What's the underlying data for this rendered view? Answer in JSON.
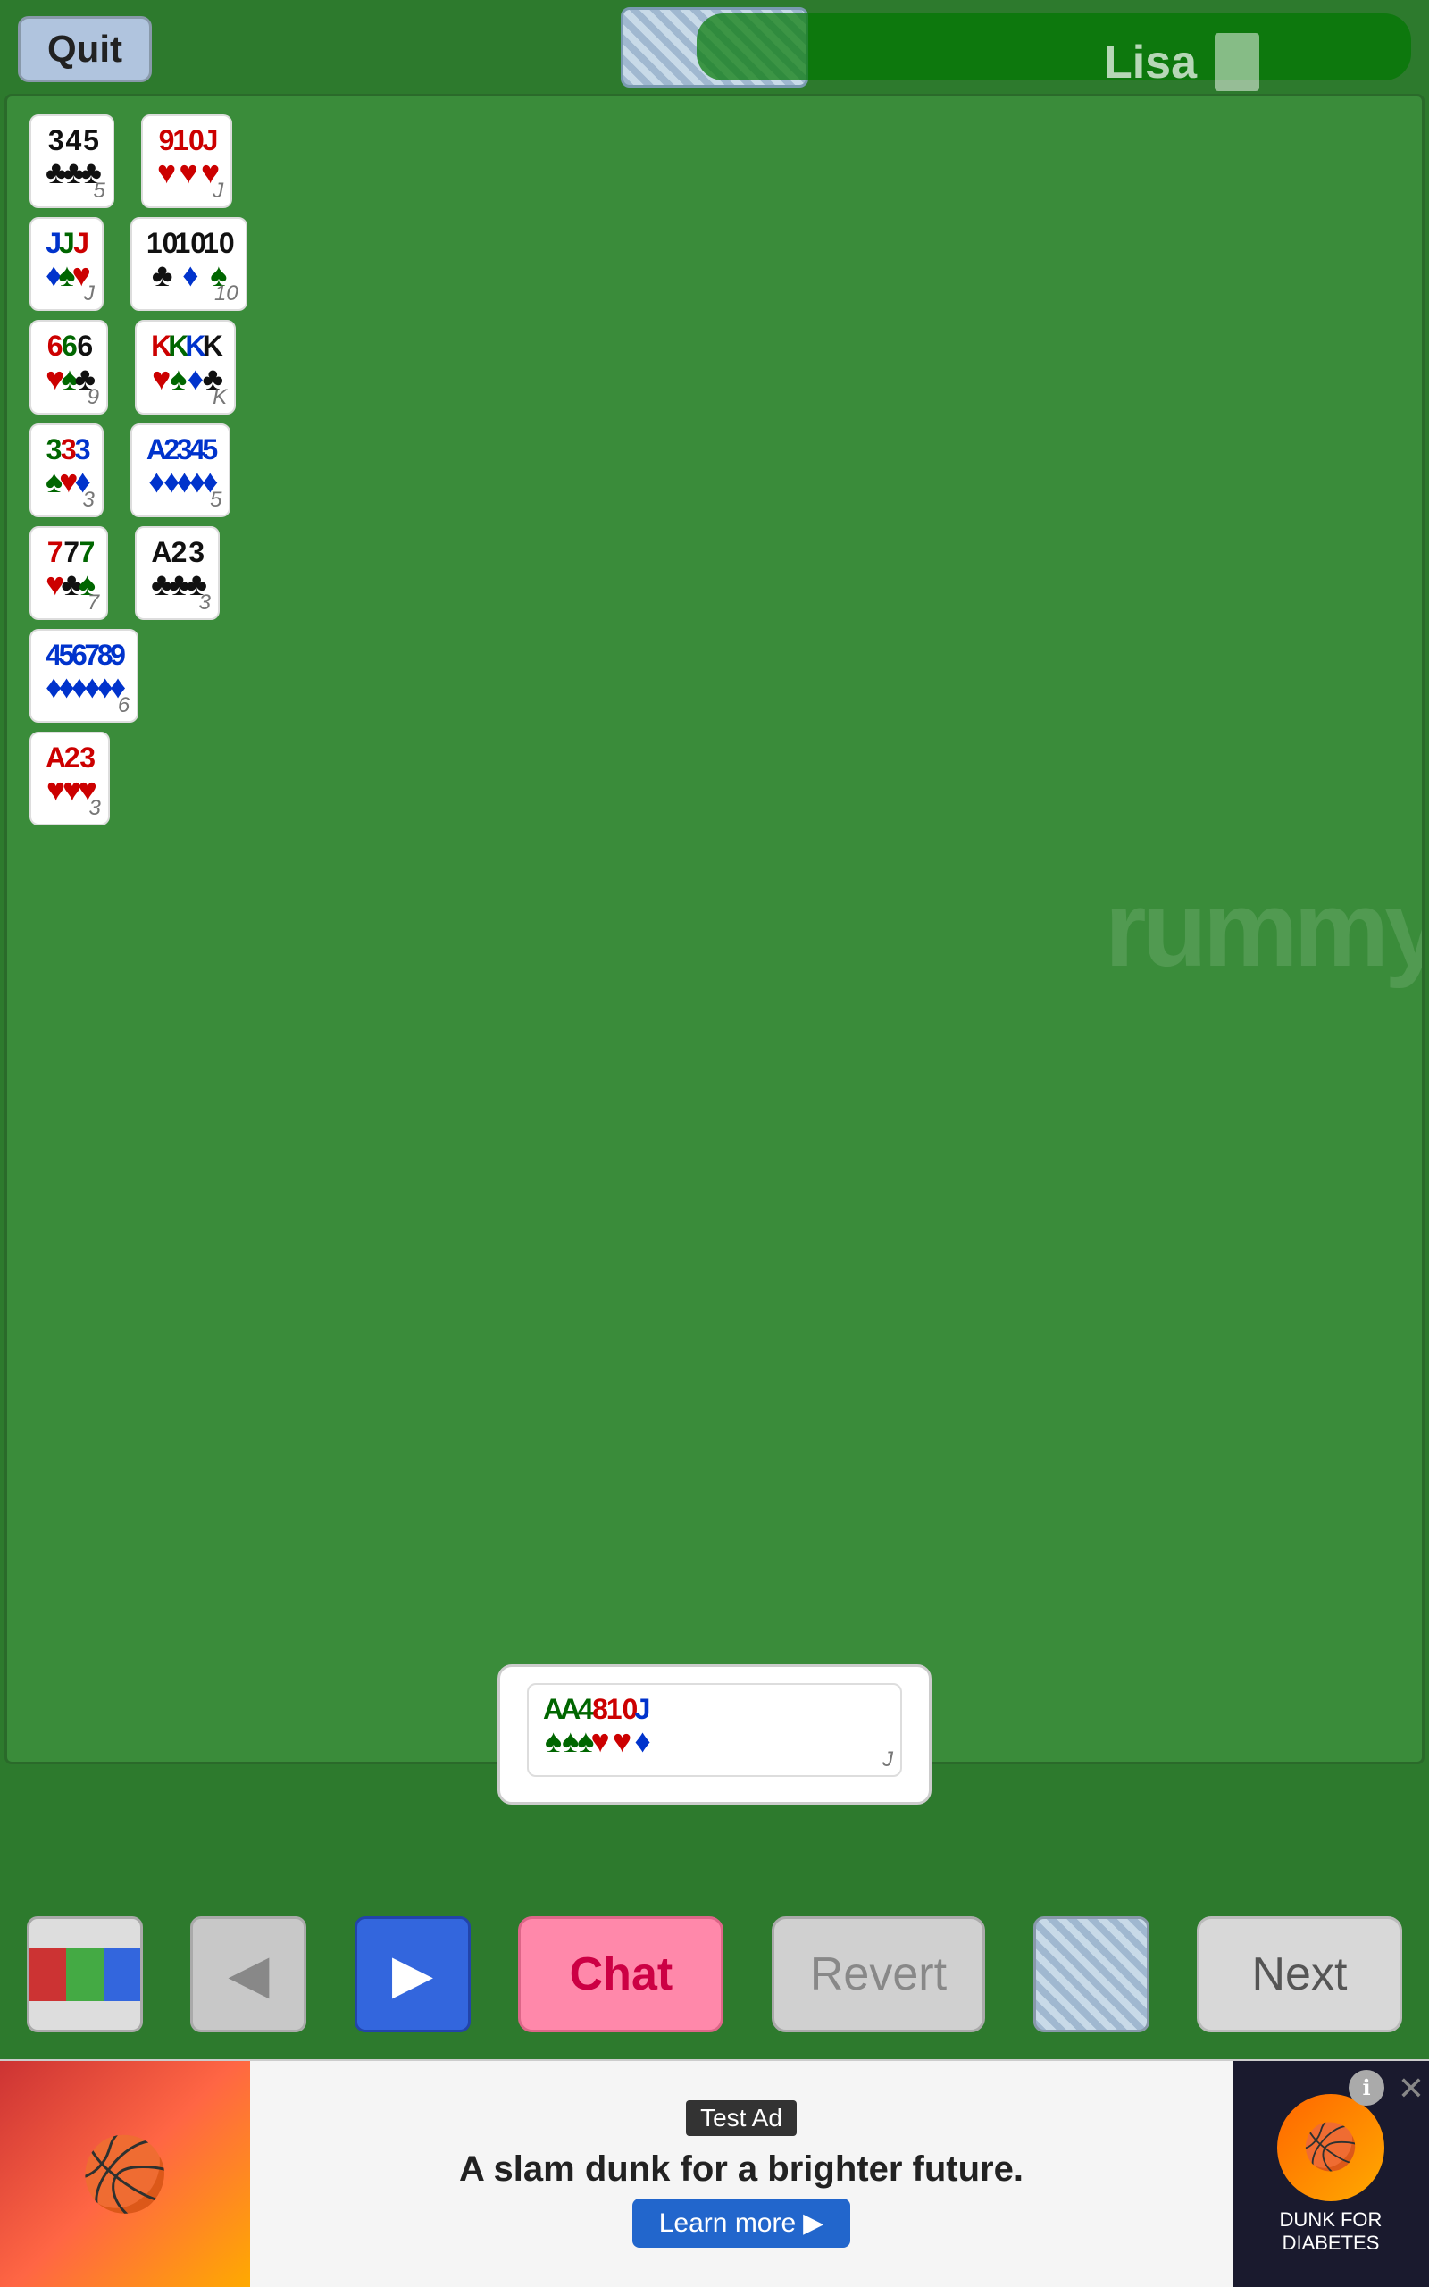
{
  "topBar": {
    "quitLabel": "Quit",
    "playerName": "Lisa",
    "deckAlt": "deck"
  },
  "gameArea": {
    "watermark": "rummy",
    "cardGroups": [
      {
        "id": "group1",
        "cards": [
          {
            "rank": "3",
            "suit": "♣",
            "suitColor": "black",
            "rankColor": "black"
          },
          {
            "rank": "4",
            "suit": "♣",
            "suitColor": "black",
            "rankColor": "black"
          },
          {
            "rank": "5",
            "suit": "♣",
            "suitColor": "black",
            "rankColor": "black"
          }
        ],
        "total": "5"
      },
      {
        "id": "group2",
        "cards": [
          {
            "rank": "9",
            "suit": "♥",
            "suitColor": "red",
            "rankColor": "red"
          },
          {
            "rank": "10",
            "suit": "♥",
            "suitColor": "red",
            "rankColor": "red"
          },
          {
            "rank": "J",
            "suit": "♥",
            "suitColor": "red",
            "rankColor": "red"
          }
        ],
        "total": "J"
      },
      {
        "id": "group3",
        "cards": [
          {
            "rank": "J",
            "suit": "♦",
            "suitColor": "blue",
            "rankColor": "blue"
          },
          {
            "rank": "J",
            "suit": "♠",
            "suitColor": "green",
            "rankColor": "green"
          },
          {
            "rank": "J",
            "suit": "♥",
            "suitColor": "red",
            "rankColor": "red"
          }
        ],
        "total": "J"
      },
      {
        "id": "group4",
        "cards": [
          {
            "rank": "10",
            "suit": "♣",
            "suitColor": "black",
            "rankColor": "black"
          },
          {
            "rank": "10",
            "suit": "♦",
            "suitColor": "blue",
            "rankColor": "black"
          },
          {
            "rank": "10",
            "suit": "♠",
            "suitColor": "green",
            "rankColor": "black"
          }
        ],
        "total": "10"
      },
      {
        "id": "group5",
        "cards": [
          {
            "rank": "6",
            "suit": "♥",
            "suitColor": "red",
            "rankColor": "red"
          },
          {
            "rank": "6",
            "suit": "♠",
            "suitColor": "green",
            "rankColor": "green"
          },
          {
            "rank": "6",
            "suit": "♣",
            "suitColor": "black",
            "rankColor": "black"
          }
        ],
        "total": "9"
      },
      {
        "id": "group6",
        "cards": [
          {
            "rank": "K",
            "suit": "♥",
            "suitColor": "red",
            "rankColor": "red"
          },
          {
            "rank": "K",
            "suit": "♠",
            "suitColor": "green",
            "rankColor": "green"
          },
          {
            "rank": "K",
            "suit": "♦",
            "suitColor": "blue",
            "rankColor": "blue"
          },
          {
            "rank": "K",
            "suit": "♣",
            "suitColor": "black",
            "rankColor": "black"
          }
        ],
        "total": "K"
      },
      {
        "id": "group7",
        "cards": [
          {
            "rank": "3",
            "suit": "♠",
            "suitColor": "green",
            "rankColor": "green"
          },
          {
            "rank": "3",
            "suit": "♥",
            "suitColor": "red",
            "rankColor": "red"
          },
          {
            "rank": "3",
            "suit": "♦",
            "suitColor": "blue",
            "rankColor": "blue"
          }
        ],
        "total": "3"
      },
      {
        "id": "group8",
        "cards": [
          {
            "rank": "A",
            "suit": "♦",
            "suitColor": "blue",
            "rankColor": "blue"
          },
          {
            "rank": "2",
            "suit": "♦",
            "suitColor": "blue",
            "rankColor": "blue"
          },
          {
            "rank": "3",
            "suit": "♦",
            "suitColor": "blue",
            "rankColor": "blue"
          },
          {
            "rank": "4",
            "suit": "♦",
            "suitColor": "blue",
            "rankColor": "blue"
          },
          {
            "rank": "5",
            "suit": "♦",
            "suitColor": "blue",
            "rankColor": "blue"
          }
        ],
        "total": "5"
      },
      {
        "id": "group9",
        "cards": [
          {
            "rank": "7",
            "suit": "♥",
            "suitColor": "red",
            "rankColor": "red"
          },
          {
            "rank": "7",
            "suit": "♣",
            "suitColor": "black",
            "rankColor": "black"
          },
          {
            "rank": "7",
            "suit": "♠",
            "suitColor": "green",
            "rankColor": "green"
          }
        ],
        "total": "7"
      },
      {
        "id": "group10",
        "cards": [
          {
            "rank": "A",
            "suit": "♣",
            "suitColor": "black",
            "rankColor": "black"
          },
          {
            "rank": "2",
            "suit": "♣",
            "suitColor": "black",
            "rankColor": "black"
          },
          {
            "rank": "3",
            "suit": "♣",
            "suitColor": "black",
            "rankColor": "black"
          }
        ],
        "total": "3"
      },
      {
        "id": "group11",
        "cards": [
          {
            "rank": "4",
            "suit": "♦",
            "suitColor": "blue",
            "rankColor": "blue"
          },
          {
            "rank": "5",
            "suit": "♦",
            "suitColor": "blue",
            "rankColor": "blue"
          },
          {
            "rank": "6",
            "suit": "♦",
            "suitColor": "blue",
            "rankColor": "blue"
          },
          {
            "rank": "7",
            "suit": "♦",
            "suitColor": "blue",
            "rankColor": "blue"
          },
          {
            "rank": "8",
            "suit": "♦",
            "suitColor": "blue",
            "rankColor": "blue"
          },
          {
            "rank": "9",
            "suit": "♦",
            "suitColor": "blue",
            "rankColor": "blue"
          }
        ],
        "total": "6"
      },
      {
        "id": "group12",
        "cards": [
          {
            "rank": "A",
            "suit": "♥",
            "suitColor": "red",
            "rankColor": "red"
          },
          {
            "rank": "2",
            "suit": "♥",
            "suitColor": "red",
            "rankColor": "red"
          },
          {
            "rank": "3",
            "suit": "♥",
            "suitColor": "red",
            "rankColor": "red"
          }
        ],
        "total": "3"
      }
    ]
  },
  "playerHand": {
    "cards": [
      {
        "rank": "A",
        "suit": "♠",
        "suitColor": "green",
        "rankColor": "green"
      },
      {
        "rank": "A",
        "suit": "♠",
        "suitColor": "green",
        "rankColor": "green"
      },
      {
        "rank": "4",
        "suit": "♠",
        "suitColor": "green",
        "rankColor": "green"
      },
      {
        "rank": "8",
        "suit": "♥",
        "suitColor": "red",
        "rankColor": "red"
      },
      {
        "rank": "10",
        "suit": "♥",
        "suitColor": "red",
        "rankColor": "red"
      },
      {
        "rank": "J",
        "suit": "♦",
        "suitColor": "blue",
        "rankColor": "blue"
      }
    ],
    "total": "J"
  },
  "bottomBar": {
    "chatLabel": "Chat",
    "revertLabel": "Revert",
    "nextLabel": "Next"
  },
  "adBanner": {
    "testLabel": "Test Ad",
    "headline": "A slam dunk for a brighter future.",
    "ctaLabel": "Learn more",
    "logoText": "DUNK FOR\nDIABETES"
  }
}
